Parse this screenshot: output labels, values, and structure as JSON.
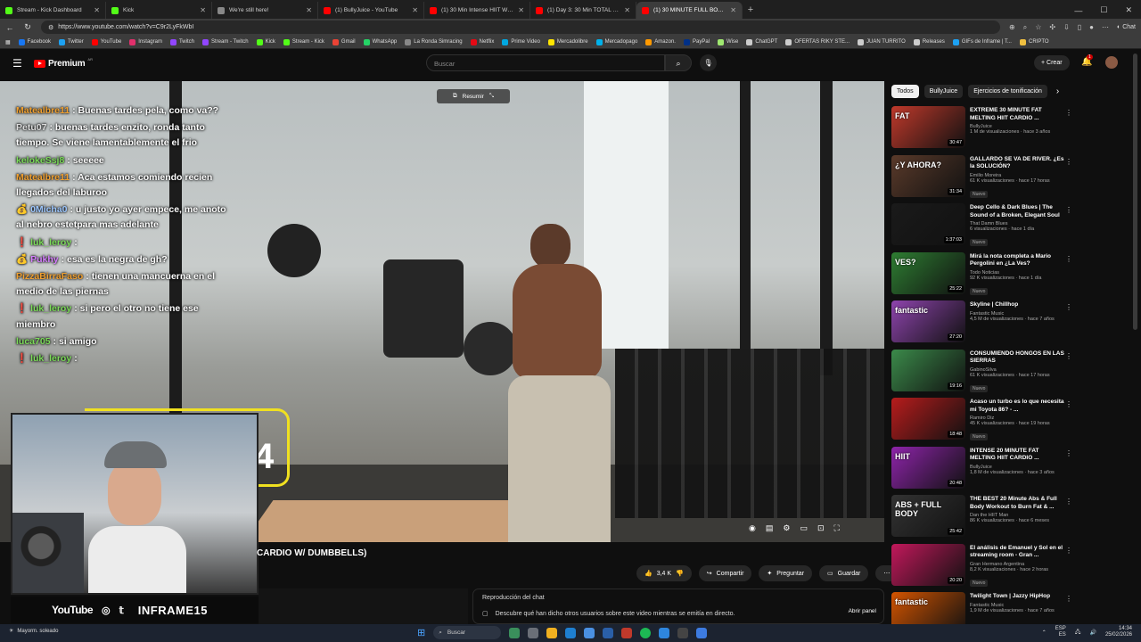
{
  "browser": {
    "tabs": [
      {
        "label": "Stream - Kick Dashboard",
        "color": "#53fc18",
        "active": false
      },
      {
        "label": "Kick",
        "color": "#53fc18",
        "active": false
      },
      {
        "label": "We're still here!",
        "color": "#888888",
        "active": false
      },
      {
        "label": "(1) BullyJuice - YouTube",
        "color": "#ff0000",
        "active": false
      },
      {
        "label": "(1) 30 Min Intense HIIT Workout F...",
        "color": "#ff0000",
        "active": false
      },
      {
        "label": "(1) Day 3: 30 Min TOTAL BODY HII...",
        "color": "#ff0000",
        "active": false
      },
      {
        "label": "(1) 30 MINUTE FULL BODY B...",
        "color": "#ff0000",
        "active": true
      }
    ],
    "url": "https://www.youtube.com/watch?v=C9r2LyFkWbI",
    "chat_label": "Chat",
    "bookmarks": [
      {
        "label": "Facebook",
        "color": "#1877f2"
      },
      {
        "label": "Twitter",
        "color": "#1da1f2"
      },
      {
        "label": "YouTube",
        "color": "#ff0000"
      },
      {
        "label": "Instagram",
        "color": "#e1306c"
      },
      {
        "label": "Twitch",
        "color": "#9146ff"
      },
      {
        "label": "Stream - Twitch",
        "color": "#9146ff"
      },
      {
        "label": "Kick",
        "color": "#53fc18"
      },
      {
        "label": "Stream - Kick",
        "color": "#53fc18"
      },
      {
        "label": "Gmail",
        "color": "#ea4335"
      },
      {
        "label": "WhatsApp",
        "color": "#25d366"
      },
      {
        "label": "La Ronda Simracing",
        "color": "#888888"
      },
      {
        "label": "Netflix",
        "color": "#e50914"
      },
      {
        "label": "Prime Video",
        "color": "#00a8e1"
      },
      {
        "label": "Mercadolibre",
        "color": "#ffe600"
      },
      {
        "label": "Mercadopago",
        "color": "#00b1ea"
      },
      {
        "label": "Amazon.",
        "color": "#ff9900"
      },
      {
        "label": "PayPal",
        "color": "#003087"
      },
      {
        "label": "Wise",
        "color": "#9fe870"
      },
      {
        "label": "ChatGPT",
        "color": "#cccccc"
      },
      {
        "label": "OFERTAS RIKY STE...",
        "color": "#cccccc"
      },
      {
        "label": "JUAN TURRITO",
        "color": "#cccccc"
      },
      {
        "label": "Releases",
        "color": "#cccccc"
      },
      {
        "label": "GIFs de Inframe | T...",
        "color": "#1da1f2"
      },
      {
        "label": "CRIPTO",
        "color": "#f0c040"
      }
    ]
  },
  "youtube": {
    "logo_text": "Premium",
    "country": "AR",
    "search_placeholder": "Buscar",
    "create_label": "Crear",
    "notifications_count": "1",
    "resume_label": "Resumir",
    "video_title_partial": "CARDIO W/ DUMBBELLS)",
    "actions": {
      "likes": "3,4 K",
      "share": "Compartir",
      "ask": "Preguntar",
      "save": "Guardar"
    },
    "chat_replay": {
      "header": "Reproducción del chat",
      "description": "Descubre qué han dicho otros usuarios sobre este video mientras se emitía en directo.",
      "open_panel": "Abrir panel"
    },
    "chips": [
      "Todos",
      "BullyJuice",
      "Ejercicios de tonificación"
    ],
    "recommendations": [
      {
        "title": "EXTREME 30 MINUTE FAT MELTING HIIT CARDIO ...",
        "channel": "BullyJuice",
        "meta": "1 M de visualizaciones · hace 3 años",
        "duration": "30:47",
        "thumb_text": "FAT",
        "bg": "#c0392b",
        "new": ""
      },
      {
        "title": "GALLARDO SE VA DE RIVER. ¿Es la SOLUCIÓN?",
        "channel": "Emilio Moreira",
        "meta": "61 K visualizaciones · hace 17 horas",
        "duration": "31:34",
        "thumb_text": "¿Y AHORA?",
        "bg": "#5a3a2a",
        "new": "Nuevo"
      },
      {
        "title": "Deep Cello & Dark Blues | The Sound of a Broken, Elegant Soul",
        "channel": "That Damn Blues",
        "meta": "6 visualizaciones · hace 1 día",
        "duration": "1:37:03",
        "thumb_text": "",
        "bg": "#1a1a1a",
        "new": "Nuevo"
      },
      {
        "title": "Mirá la nota completa a Mario Pergolini en ¿La Ves?",
        "channel": "Todo Noticias",
        "meta": "92 K visualizaciones · hace 1 día",
        "duration": "25:22",
        "thumb_text": "VES?",
        "bg": "#2e7d32",
        "new": "Nuevo"
      },
      {
        "title": "Skyline | Chillhop",
        "channel": "Fantastic Music",
        "meta": "4,5 M de visualizaciones · hace 7 años",
        "duration": "27:20",
        "thumb_text": "fantastic",
        "bg": "#8e44ad",
        "new": ""
      },
      {
        "title": "CONSUMIENDO HONGOS EN LAS SIERRAS",
        "channel": "GabinoSilva",
        "meta": "61 K visualizaciones · hace 17 horas",
        "duration": "19:16",
        "thumb_text": "",
        "bg": "#3b8a4a",
        "new": "Nuevo"
      },
      {
        "title": "Acaso un turbo es lo que necesita mi Toyota 86? - ...",
        "channel": "Ramiro Diz",
        "meta": "45 K visualizaciones · hace 19 horas",
        "duration": "18:48",
        "thumb_text": "",
        "bg": "#b71c1c",
        "new": "Nuevo"
      },
      {
        "title": "INTENSE 20 MINUTE FAT MELTING HIIT CARDIO ...",
        "channel": "BullyJuice",
        "meta": "1,8 M de visualizaciones · hace 3 años",
        "duration": "20:48",
        "thumb_text": "HIIT",
        "bg": "#8e24aa",
        "new": ""
      },
      {
        "title": "THE BEST 20 Minute Abs & Full Body Workout to Burn Fat & ...",
        "channel": "Dan the HIIT Man",
        "meta": "86 K visualizaciones · hace 6 meses",
        "duration": "25:42",
        "thumb_text": "ABS + FULL BODY",
        "bg": "#333333",
        "new": ""
      },
      {
        "title": "El análisis de Emanuel y Sol en el streaming room - Gran ...",
        "channel": "Gran Hermano Argentina",
        "meta": "8,2 K visualizaciones · hace 2 horas",
        "duration": "20:20",
        "thumb_text": "",
        "bg": "#c2185b",
        "new": "Nuevo"
      },
      {
        "title": "Twilight Town | Jazzy HipHop",
        "channel": "Fantastic Music",
        "meta": "1,9 M de visualizaciones · hace 7 años",
        "duration": "31:53",
        "thumb_text": "fantastic",
        "bg": "#d35400",
        "new": ""
      }
    ]
  },
  "stream_overlay": {
    "chat": [
      {
        "user": "Matealbre11",
        "text": ": Buenas tardes pela, como va??",
        "color": "#f0a030",
        "badge": ""
      },
      {
        "user": "Petu07",
        "text": ": buenas tardes enzito, ronda tanto tiempo. Se viene lamentablemente el frio",
        "color": "#dddddd",
        "badge": ""
      },
      {
        "user": "kelokeSsj8",
        "text": ": seeeee",
        "color": "#7cdc5a",
        "badge": ""
      },
      {
        "user": "Matealbre11",
        "text": ": Aca estamos comiendo recien llegados del laburoo",
        "color": "#f0a030",
        "badge": ""
      },
      {
        "user": "0Micha0",
        "text": ": u justo yo ayer empece, me anoto al nebro estetpara mas adelante",
        "color": "#9ec8ff",
        "badge": "💰"
      },
      {
        "user": "luk_leroy",
        "text": ":",
        "color": "#7cdc5a",
        "badge": "❗"
      },
      {
        "user": "Pukhy",
        "text": ": esa es la negra de gh?",
        "color": "#d780ff",
        "badge": "💰"
      },
      {
        "user": "PizzaBirraFaso",
        "text": ": tienen una mancuerna en el medio de las piernas",
        "color": "#f0a030",
        "badge": ""
      },
      {
        "user": "luk_leroy",
        "text": ": si pero el otro no tiene ese miembro",
        "color": "#7cdc5a",
        "badge": "❗"
      },
      {
        "user": "luca705",
        "text": ": si amigo",
        "color": "#7cdc5a",
        "badge": ""
      },
      {
        "user": "luk_leroy",
        "text": ":",
        "color": "#7cdc5a",
        "badge": "❗"
      }
    ],
    "timer_digit": "4",
    "socials": {
      "youtube": "YouTube",
      "brand": "INFRAME15"
    }
  },
  "taskbar": {
    "weather": "Mayorm. soleado",
    "search_label": "Buscar",
    "lang_top": "ESP",
    "lang_bottom": "ES",
    "time": "14:34",
    "date": "25/02/2026"
  }
}
